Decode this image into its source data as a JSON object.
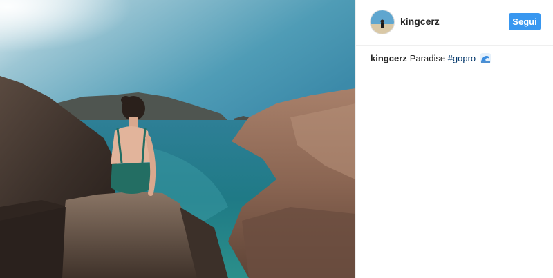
{
  "post": {
    "photo": {
      "alt_name": "beach-photo"
    },
    "header": {
      "username": "kingcerz",
      "follow_label": "Segui"
    },
    "caption": {
      "username": "kingcerz",
      "text": "Paradise",
      "hashtag": "#gopro",
      "emoji_icon": "wave-icon"
    }
  },
  "colors": {
    "follow_button": "#3897f0",
    "hashtag": "#003569",
    "text": "#262626",
    "divider": "#efefef"
  }
}
